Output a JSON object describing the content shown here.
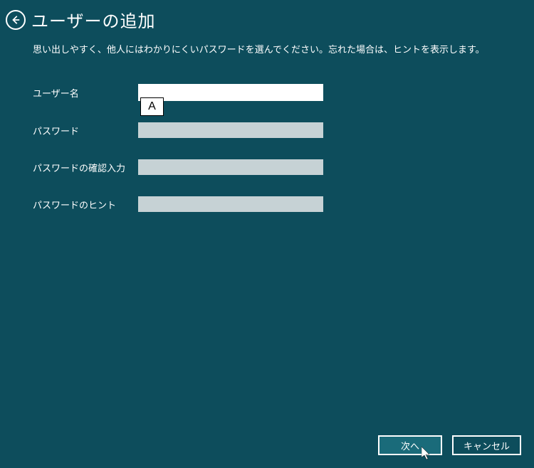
{
  "header": {
    "title": "ユーザーの追加"
  },
  "subtitle": "思い出しやすく、他人にはわかりにくいパスワードを選んでください。忘れた場合は、ヒントを表示します。",
  "form": {
    "username_label": "ユーザー名",
    "username_value": "",
    "password_label": "パスワード",
    "password_value": "",
    "confirm_label": "パスワードの確認入力",
    "confirm_value": "",
    "hint_label": "パスワードのヒント",
    "hint_value": ""
  },
  "ime": {
    "mode": "A"
  },
  "buttons": {
    "next": "次へ",
    "cancel": "キャンセル"
  }
}
